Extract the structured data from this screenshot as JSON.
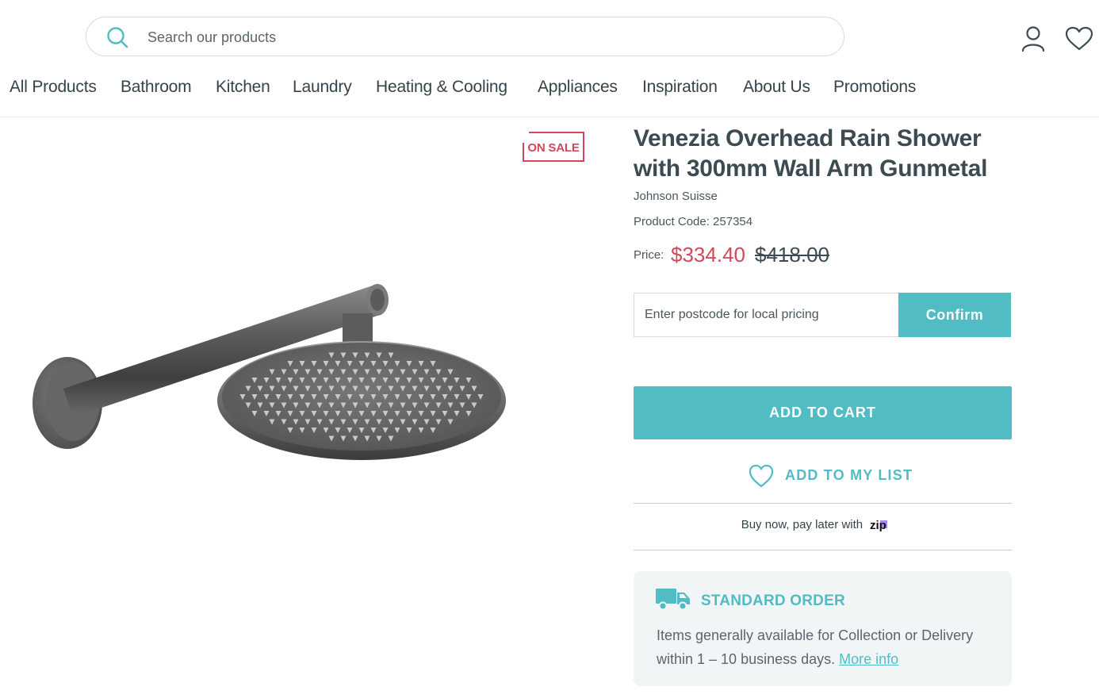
{
  "header": {
    "search": {
      "placeholder": "Search our products",
      "value": "",
      "icon": "search-icon"
    },
    "account_icon": "account-icon",
    "wishlist_icon": "heart-icon"
  },
  "nav": {
    "items": [
      "All Products",
      "Bathroom",
      "Kitchen",
      "Laundry",
      "Heating & Cooling",
      "Appliances",
      "Inspiration",
      "About Us",
      "Promotions"
    ]
  },
  "product": {
    "badge": "ON SALE",
    "title": "Venezia Overhead Rain Shower with 300mm Wall Arm Gunmetal",
    "brand": "Johnson Suisse",
    "code_label": "Product Code: 257354",
    "price_label": "Price:",
    "sale_price": "$334.40",
    "old_price": "$418.00"
  },
  "postcode": {
    "placeholder": "Enter postcode for local pricing",
    "confirm_label": "Confirm"
  },
  "actions": {
    "add_to_cart": "ADD TO CART",
    "add_to_list": "ADD TO MY LIST"
  },
  "zip": {
    "text": "Buy now, pay later with",
    "logo_text": "zip"
  },
  "standard_order": {
    "title": "STANDARD ORDER",
    "text": "Items generally available for Collection or Delivery within 1 – 10 business days.",
    "link": "More info"
  },
  "colors": {
    "accent": "#52bcc4",
    "sale": "#d2475c",
    "text": "#3c4a52",
    "card_bg": "#f2f5f6"
  }
}
